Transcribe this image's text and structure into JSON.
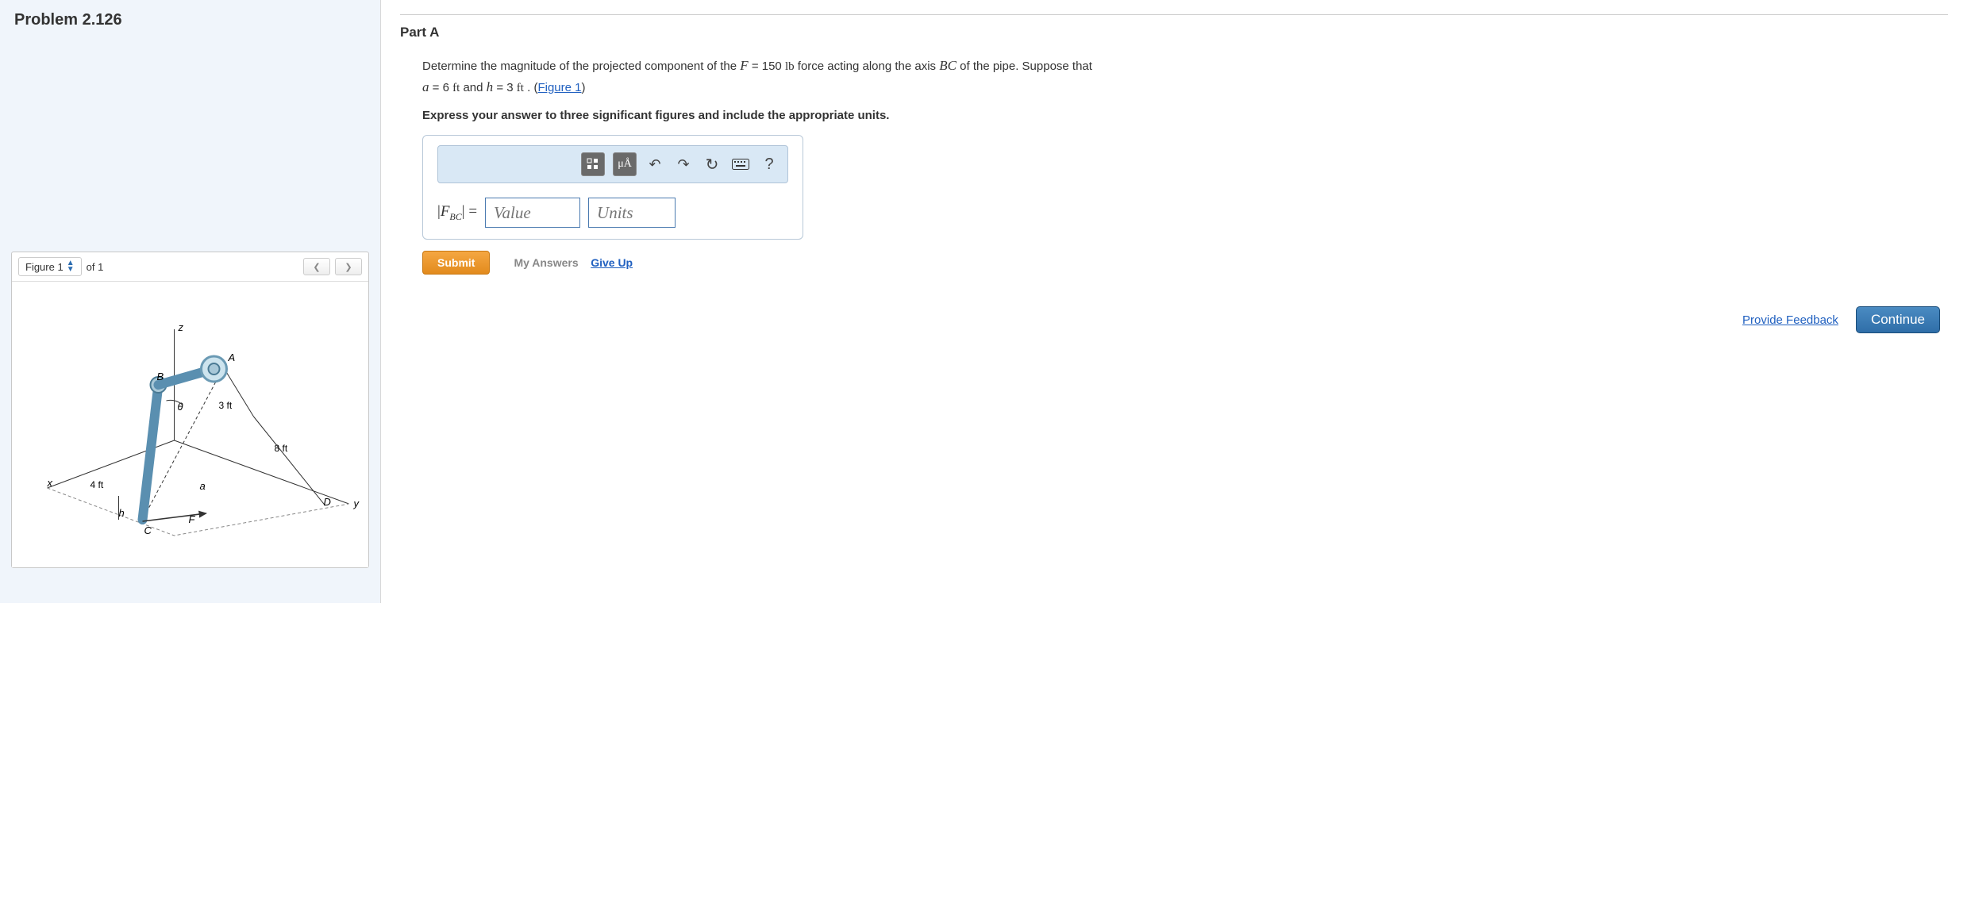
{
  "problem": {
    "title": "Problem 2.126"
  },
  "figure": {
    "label": "Figure 1",
    "of": "of 1",
    "labels": {
      "z": "z",
      "x": "x",
      "y": "y",
      "A": "A",
      "B": "B",
      "C": "C",
      "D": "D",
      "F": "F",
      "theta": "θ",
      "a": "a",
      "h": "h",
      "d3ft": "3 ft",
      "d4ft": "4 ft",
      "d8ft": "8 ft"
    }
  },
  "part": {
    "title": "Part A",
    "q1a": "Determine the magnitude of the projected component of the ",
    "q1b": " = 150 ",
    "q1c": " force acting along the axis ",
    "q1d": " of the pipe. Suppose that ",
    "q2a": " = 6 ",
    "q2b": " and ",
    "q2c": " = 3 ",
    "q2d": " . (",
    "figlink": "Figure 1",
    "q2e": ")",
    "vars": {
      "F": "F",
      "lb": "lb",
      "BC": "BC",
      "a": "a",
      "ft": "ft",
      "h": "h"
    },
    "instruction": "Express your answer to three significant figures and include the appropriate units."
  },
  "answer": {
    "label_pre": "|",
    "label_F": "F",
    "label_sub": "BC",
    "label_post": "| =",
    "value_ph": "Value",
    "units_ph": "Units",
    "mu": "μÅ",
    "help": "?"
  },
  "actions": {
    "submit": "Submit",
    "my_answers": "My Answers",
    "give_up": "Give Up",
    "feedback": "Provide Feedback",
    "continue": "Continue"
  }
}
